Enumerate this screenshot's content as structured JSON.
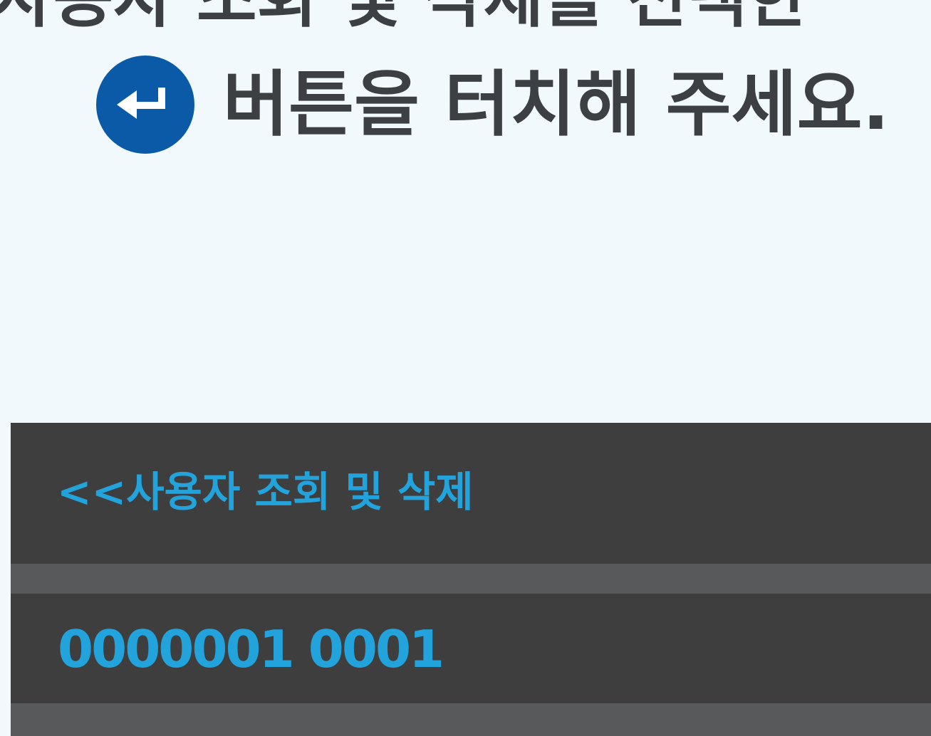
{
  "instruction": {
    "line1": "사용자 조회 및 삭제를 선택한",
    "line2": "버튼을 터치해 주세요.",
    "enter_icon": "enter-return-icon"
  },
  "panel": {
    "title": "<<사용자 조회 및 삭제",
    "value": "0000001 0001"
  },
  "colors": {
    "background": "#f2f9fd",
    "instruction_text": "#3d4043",
    "enter_button": "#0a5aa8",
    "panel_background": "#3e3e3e",
    "panel_divider": "#58595b",
    "accent": "#23a3dc"
  }
}
